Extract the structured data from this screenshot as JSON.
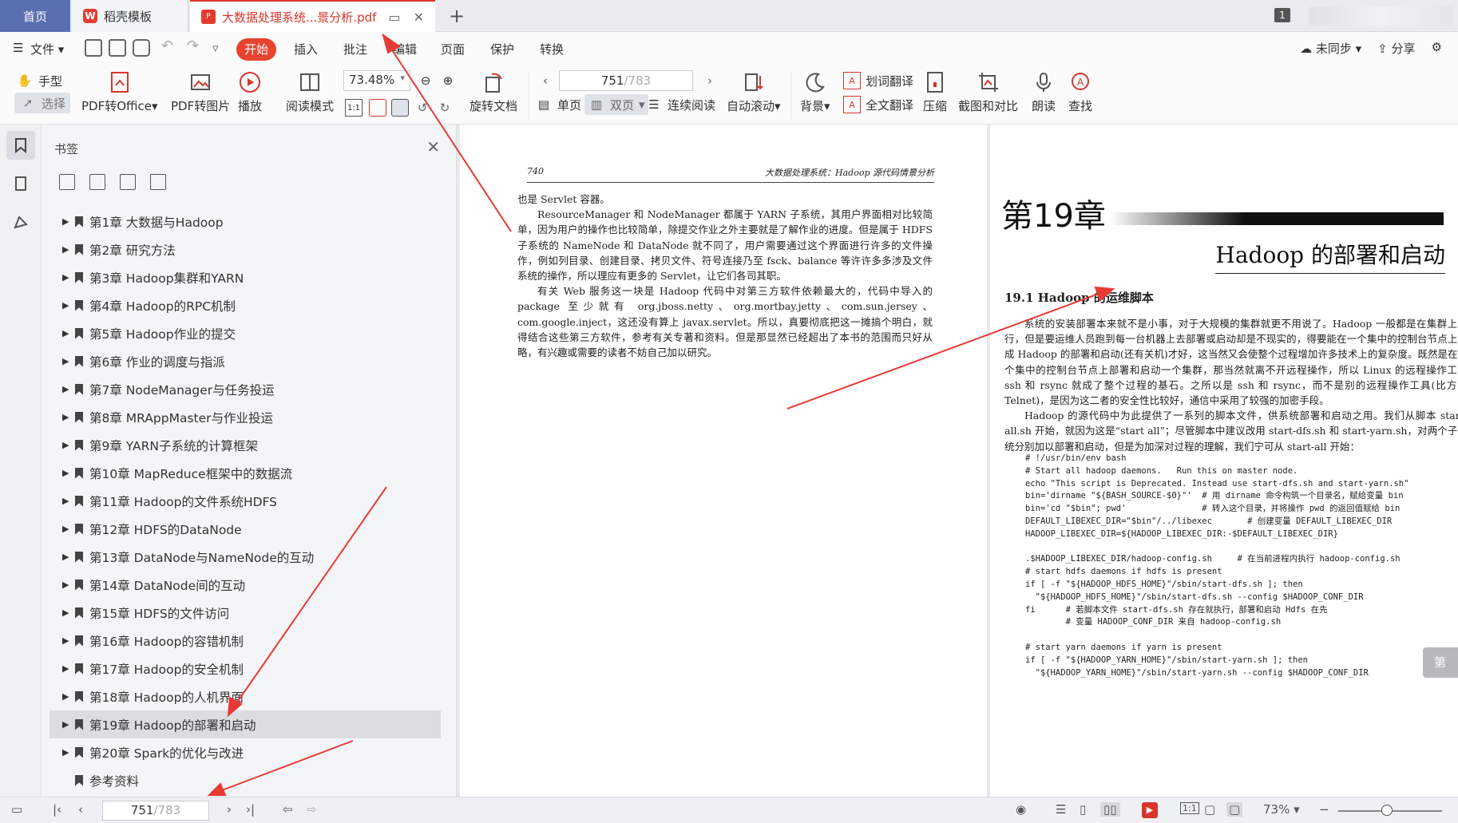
{
  "tabs": {
    "home": "首页",
    "docer": "稻壳模板",
    "pdf": "大数据处理系统...景分析.pdf",
    "badge": "1"
  },
  "menu": {
    "file": "文件",
    "start": "开始",
    "insert": "插入",
    "annotate": "批注",
    "edit": "编辑",
    "page": "页面",
    "protect": "保护",
    "convert": "转换",
    "sync": "未同步",
    "share": "分享"
  },
  "toolbar": {
    "hand": "手型",
    "select": "选择",
    "pdf_to_office": "PDF转Office",
    "pdf_to_image": "PDF转图片",
    "play": "播放",
    "read_mode": "阅读模式",
    "zoom": "73.48%",
    "rotate": "旋转文档",
    "page_current": "751",
    "page_total": "/783",
    "single": "单页",
    "double": "双页",
    "continuous": "连续阅读",
    "autoscroll": "自动滚动",
    "background": "背景",
    "word_translate": "划词翻译",
    "full_translate": "全文翻译",
    "compress": "压缩",
    "screenshot": "截图和对比",
    "read_aloud": "朗读",
    "find": "查找"
  },
  "panel": {
    "title": "书签",
    "bookmarks": [
      "第1章  大数据与Hadoop",
      "第2章  研究方法",
      "第3章  Hadoop集群和YARN",
      "第4章  Hadoop的RPC机制",
      "第5章  Hadoop作业的提交",
      "第6章  作业的调度与指派",
      "第7章  NodeManager与任务投运",
      "第8章  MRAppMaster与作业投运",
      "第9章  YARN子系统的计算框架",
      "第10章  MapReduce框架中的数据流",
      "第11章  Hadoop的文件系统HDFS",
      "第12章  HDFS的DataNode",
      "第13章  DataNode与NameNode的互动",
      "第14章  DataNode间的互动",
      "第15章  HDFS的文件访问",
      "第16章  Hadoop的容错机制",
      "第17章  Hadoop的安全机制",
      "第18章  Hadoop的人机界面",
      "第19章  Hadoop的部署和启动",
      "第20章  Spark的优化与改进",
      "参考资料"
    ],
    "selected_index": 18
  },
  "left_page": {
    "number": "740",
    "running_head": "大数据处理系统：Hadoop 源代码情景分析",
    "p0": "也是 Servlet 容器。",
    "p1": "ResourceManager 和 NodeManager 都属于 YARN 子系统，其用户界面相对比较简单，因为用户的操作也比较简单，除提交作业之外主要就是了解作业的进度。但是属于 HDFS 子系统的 NameNode 和 DataNode 就不同了，用户需要通过这个界面进行许多的文件操作，例如列目录、创建目录、拷贝文件、符号连接乃至 fsck、balance 等许许多多涉及文件系统的操作，所以理应有更多的 Servlet，让它们各司其职。",
    "p2": "有关 Web 服务这一块是 Hadoop 代码中对第三方软件依赖最大的，代码中导入的 package 至少就有 org.jboss.netty、org.mortbay.jetty、com.sun.jersey、com.google.inject，这还没有算上 javax.servlet。所以，真要彻底把这一摊搞个明白，就得结合这些第三方软件，参考有关专著和资料。但是那显然已经超出了本书的范围而只好从略，有兴趣或需要的读者不妨自己加以研究。"
  },
  "right_page": {
    "chapter_num": "第19章",
    "chapter_title": "Hadoop 的部署和启动",
    "section": "19.1    Hadoop 的运维脚本",
    "p1": "系统的安装部署本来就不是小事，对于大规模的集群就更不用说了。Hadoop 一般都是在集群上运行，但是要运维人员跑到每一台机器上去部署或启动却是不现实的，得要能在一个集中的控制台节点上完成 Hadoop 的部署和启动(还有关机)才好，这当然又会使整个过程增加许多技术上的复杂度。既然是在一个集中的控制台节点上部署和启动一个集群，那当然就离不开远程操作，所以 Linux 的远程操作工具 ssh 和 rsync 就成了整个过程的基石。之所以是 ssh 和 rsync，而不是别的远程操作工具(比方说 Telnet)，是因为这二者的安全性比较好，通信中采用了较强的加密手段。",
    "p2": "Hadoop 的源代码中为此提供了一系列的脚本文件，供系统部署和启动之用。我们从脚本 start-all.sh 开始，就因为这是“start all”；尽管脚本中建议改用 start-dfs.sh 和 start-yarn.sh，对两个子系统分别加以部署和启动，但是为加深对过程的理解，我们宁可从 start-all 开始：",
    "code": "# !/usr/bin/env bash\n# Start all hadoop daemons.   Run this on master node.\necho \"This script is Deprecated. Instead use start-dfs.sh and start-yarn.sh\"\nbin='dirname \"${BASH_SOURCE-$0}\"'  # 用 dirname 命令构筑一个目录名，赋给变量 bin\nbin='cd \"$bin\"; pwd'               # 转入这个目录，并将操作 pwd 的返回值赋给 bin\nDEFAULT_LIBEXEC_DIR=\"$bin\"/../libexec       # 创建变量 DEFAULT_LIBEXEC_DIR\nHADOOP_LIBEXEC_DIR=${HADOOP_LIBEXEC_DIR:-$DEFAULT_LIBEXEC_DIR}\n\n.$HADOOP_LIBEXEC_DIR/hadoop-config.sh     # 在当前进程内执行 hadoop-config.sh\n# start hdfs daemons if hdfs is present\nif [ -f \"${HADOOP_HDFS_HOME}\"/sbin/start-dfs.sh ]; then\n  \"${HADOOP_HDFS_HOME}\"/sbin/start-dfs.sh --config $HADOOP_CONF_DIR\nfi      # 若脚本文件 start-dfs.sh 存在就执行，部署和启动 Hdfs 在先\n        # 变量 HADOOP_CONF_DIR 来自 hadoop-config.sh\n\n# start yarn daemons if yarn is present\nif [ -f \"${HADOOP_YARN_HOME}\"/sbin/start-yarn.sh ]; then\n  \"${HADOOP_YARN_HOME}\"/sbin/start-yarn.sh --config $HADOOP_CONF_DIR",
    "next_chip": "第"
  },
  "status": {
    "page_current": "751",
    "page_total": "/783",
    "zoom": "73%"
  },
  "colors": {
    "accent": "#e8432f",
    "home_tab": "#5a6fb0",
    "arrow": "#e83a35"
  }
}
